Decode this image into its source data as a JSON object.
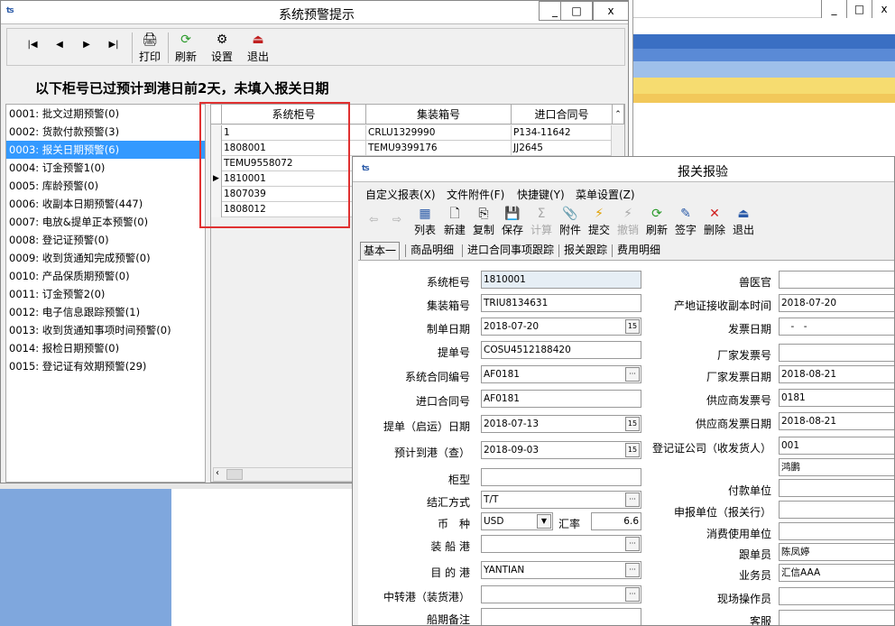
{
  "window1": {
    "title": "系统预警提示",
    "controls": [
      "_",
      "□",
      "x"
    ],
    "nav": [
      "|◀",
      "◀",
      "▶",
      "▶|"
    ],
    "toolbar": [
      {
        "icon": "printer-icon",
        "label": "打印"
      },
      {
        "icon": "refresh-icon",
        "label": "刷新"
      },
      {
        "icon": "settings-icon",
        "label": "设置"
      },
      {
        "icon": "exit-icon",
        "label": "退出"
      }
    ],
    "banner": "以下柜号已过预计到港日前2天，未填入报关日期",
    "alerts": [
      "0001: 批文过期预警(0)",
      "0002: 货款付款预警(3)",
      "0003: 报关日期预警(6)",
      "0004: 订金预警1(0)",
      "0005: 库龄预警(0)",
      "0006: 收副本日期预警(447)",
      "0007: 电放&提单正本预警(0)",
      "0008: 登记证预警(0)",
      "0009: 收到货通知完成预警(0)",
      "0010: 产品保质期预警(0)",
      "0011: 订金预警2(0)",
      "0012: 电子信息跟踪预警(1)",
      "0013: 收到货通知事项时间预警(0)",
      "0014: 报检日期预警(0)",
      "0015: 登记证有效期预警(29)"
    ],
    "selected_alert": 2,
    "grid": {
      "columns": [
        "系统柜号",
        "集装箱号",
        "进口合同号"
      ],
      "rows": [
        [
          "1",
          "CRLU1329990",
          "P134-11642"
        ],
        [
          "1808001",
          "TEMU9399176",
          "JJ2645"
        ],
        [
          "TEMU9558072",
          "",
          ""
        ],
        [
          "1810001",
          "",
          ""
        ],
        [
          "1807039",
          "",
          ""
        ],
        [
          "1808012",
          "",
          ""
        ]
      ],
      "current_row": 3
    }
  },
  "background": {
    "controls": [
      "_",
      "□",
      "x"
    ]
  },
  "window2": {
    "title": "报关报验",
    "menu": [
      "自定义报表(X)",
      "文件附件(F)",
      "快捷键(Y)",
      "菜单设置(Z)"
    ],
    "toolbar": [
      {
        "icon": "list-icon",
        "label": "列表",
        "enabled": true
      },
      {
        "icon": "new-icon",
        "label": "新建",
        "enabled": true
      },
      {
        "icon": "copy-icon",
        "label": "复制",
        "enabled": true
      },
      {
        "icon": "save-icon",
        "label": "保存",
        "enabled": true
      },
      {
        "icon": "sum-icon",
        "label": "计算",
        "enabled": false
      },
      {
        "icon": "paperclip-icon",
        "label": "附件",
        "enabled": true
      },
      {
        "icon": "lightning-icon",
        "label": "提交",
        "enabled": true
      },
      {
        "icon": "lightning-icon",
        "label": "撤销",
        "enabled": false
      },
      {
        "icon": "refresh-icon",
        "label": "刷新",
        "enabled": true
      },
      {
        "icon": "pen-icon",
        "label": "签字",
        "enabled": true
      },
      {
        "icon": "delete-icon",
        "label": "删除",
        "enabled": true
      },
      {
        "icon": "exit-icon",
        "label": "退出",
        "enabled": true
      }
    ],
    "tabs": [
      "基本一",
      "商品明细",
      "进口合同事项跟踪",
      "报关跟踪",
      "费用明细"
    ],
    "left_fields": [
      {
        "label": "系统柜号",
        "value": "1810001"
      },
      {
        "label": "集装箱号",
        "value": "TRIU8134631"
      },
      {
        "label": "制单日期",
        "value": "2018-07-20"
      },
      {
        "label": "提单号",
        "value": "COSU4512188420"
      },
      {
        "label": "系统合同编号",
        "value": "AF0181"
      },
      {
        "label": "进口合同号",
        "value": "AF0181"
      },
      {
        "label": "提单（启运）日期",
        "value": "2018-07-13"
      },
      {
        "label": "预计到港（查）",
        "value": "2018-09-03"
      },
      {
        "label": "柜型",
        "value": ""
      },
      {
        "label": "结汇方式",
        "value": "T/T"
      },
      {
        "label": "币　种",
        "value": "USD"
      },
      {
        "label": "装 船 港",
        "value": ""
      },
      {
        "label": "目 的 港",
        "value": "YANTIAN"
      },
      {
        "label": "中转港（装货港）",
        "value": ""
      },
      {
        "label": "船期备注",
        "value": ""
      }
    ],
    "exchange_rate": {
      "label": "汇率",
      "value": "6.6"
    },
    "right_fields": [
      {
        "label": "兽医官",
        "value": ""
      },
      {
        "label": "产地证接收副本时间",
        "value": "2018-07-20"
      },
      {
        "label": "发票日期",
        "value": "　-　-"
      },
      {
        "label": "厂家发票号",
        "value": ""
      },
      {
        "label": "厂家发票日期",
        "value": "2018-08-21"
      },
      {
        "label": "供应商发票号",
        "value": "0181"
      },
      {
        "label": "供应商发票日期",
        "value": "2018-08-21"
      },
      {
        "label": "登记证公司（收发货人）",
        "value": "001"
      },
      {
        "label": "",
        "value": "鸿鹏"
      },
      {
        "label": "付款单位",
        "value": ""
      },
      {
        "label": "申报单位（报关行）",
        "value": ""
      },
      {
        "label": "消费使用单位",
        "value": ""
      },
      {
        "label": "跟单员",
        "value": "陈凤婷"
      },
      {
        "label": "业务员",
        "value": "汇信AAA"
      },
      {
        "label": "现场操作员",
        "value": ""
      },
      {
        "label": "客服",
        "value": ""
      }
    ]
  }
}
